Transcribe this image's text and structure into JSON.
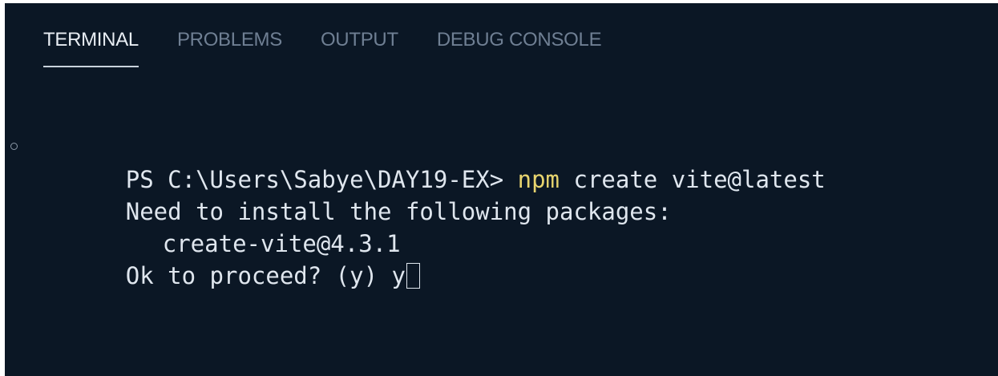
{
  "tabs": [
    {
      "label": "TERMINAL",
      "active": true
    },
    {
      "label": "PROBLEMS",
      "active": false
    },
    {
      "label": "OUTPUT",
      "active": false
    },
    {
      "label": "DEBUG CONSOLE",
      "active": false
    }
  ],
  "terminal": {
    "prompt": "PS C:\\Users\\Sabye\\DAY19-EX> ",
    "command": "npm",
    "args": " create vite@latest",
    "output_line_1": "Need to install the following packages:",
    "output_line_2": "create-vite@4.3.1",
    "question": "Ok to proceed? (y) ",
    "answer": "y"
  },
  "colors": {
    "background": "#0b1725",
    "command": "#e7d46e",
    "text": "#dfe6ee",
    "inactive_tab": "#6f7f93"
  }
}
